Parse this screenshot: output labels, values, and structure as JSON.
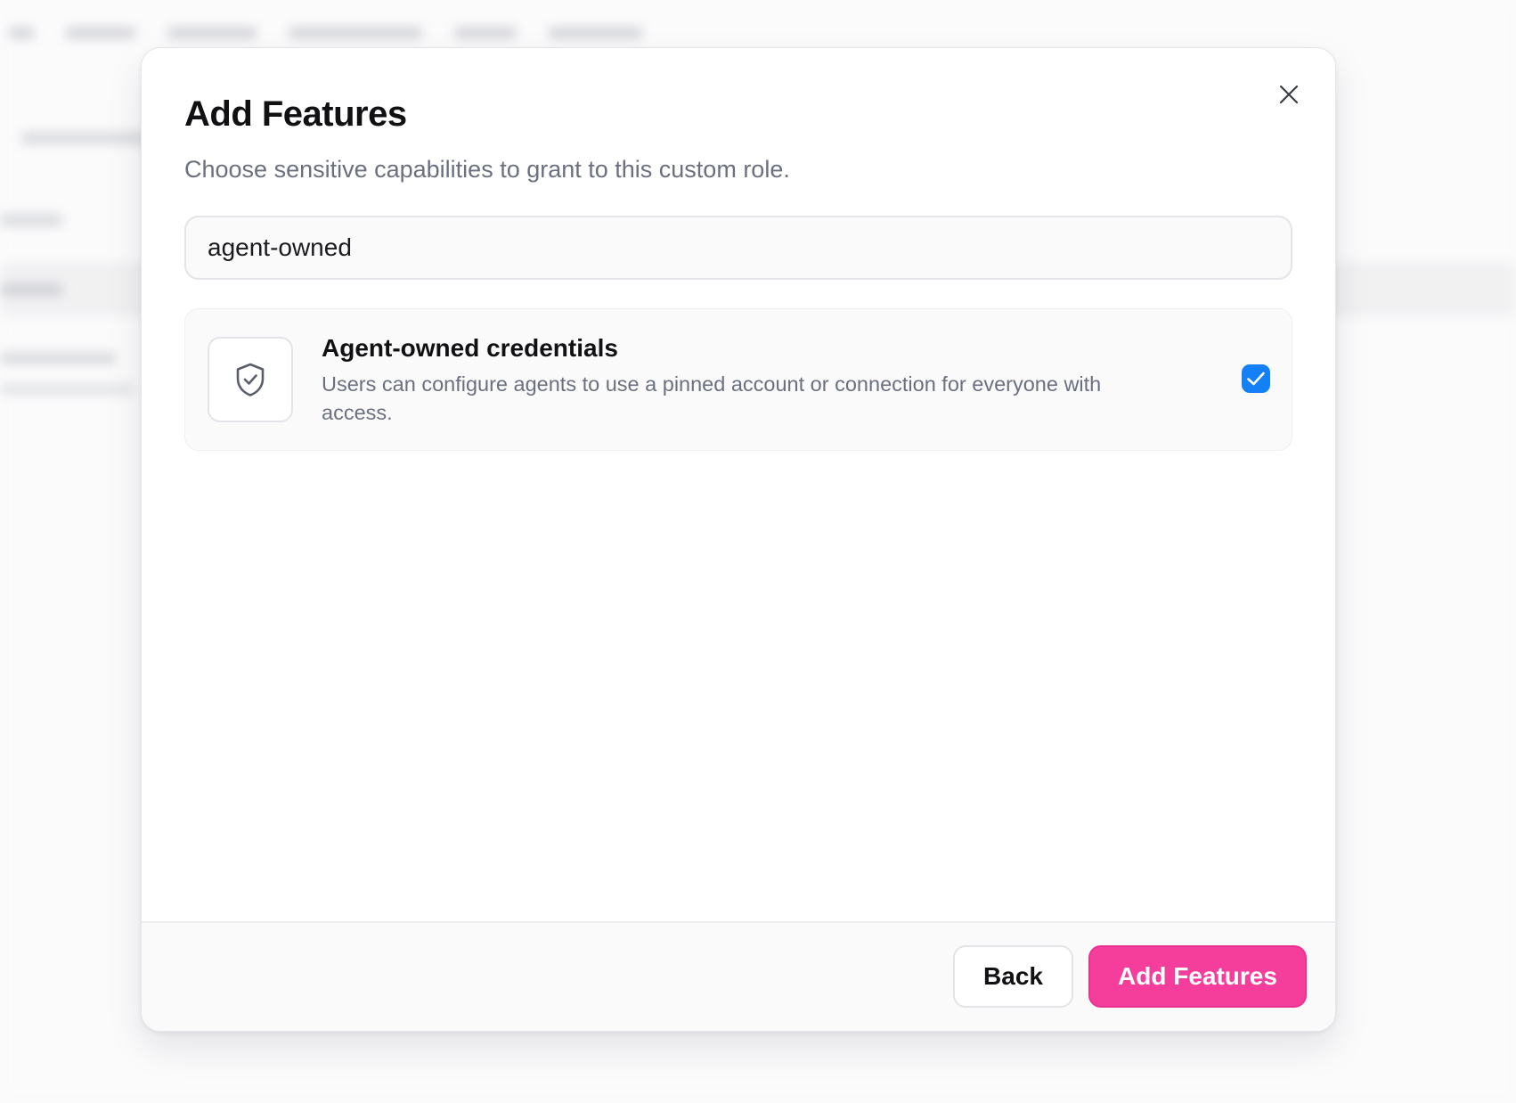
{
  "modal": {
    "title": "Add Features",
    "subtitle": "Choose sensitive capabilities to grant to this custom role.",
    "close_icon": "close-icon"
  },
  "search": {
    "value": "agent-owned",
    "placeholder": ""
  },
  "features": [
    {
      "icon": "shield-check-icon",
      "title": "Agent-owned credentials",
      "description": "Users can configure agents to use a pinned account or connection for everyone with access.",
      "checked": true
    }
  ],
  "footer": {
    "back_label": "Back",
    "add_label": "Add Features"
  },
  "colors": {
    "accent_pink": "#f53d9b",
    "checkbox_blue": "#1480f5"
  }
}
